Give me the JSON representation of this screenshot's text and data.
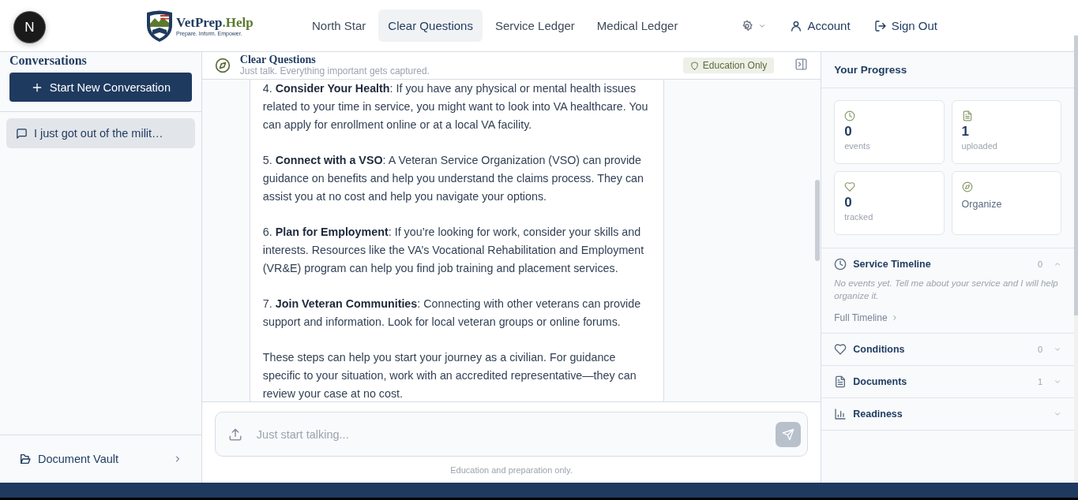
{
  "dev_badge": {
    "label": "N"
  },
  "header": {
    "logo": {
      "name": "VetPrep",
      "name_accent": ".Help",
      "tagline": "Prepare. Inform. Empower."
    },
    "nav": [
      {
        "label": "North Star",
        "selected": false
      },
      {
        "label": "Clear Questions",
        "selected": true
      },
      {
        "label": "Service Ledger",
        "selected": false
      },
      {
        "label": "Medical Ledger",
        "selected": false
      }
    ],
    "account": "Account",
    "sign_out": "Sign Out"
  },
  "sidebar": {
    "title": "Conversations",
    "new_button": "Start New Conversation",
    "conversations": [
      {
        "label": "I just got out of the milit…",
        "selected": true
      }
    ],
    "vault": "Document Vault"
  },
  "chat": {
    "title": "Clear Questions",
    "subtitle": "Just talk. Everything important gets captured.",
    "badge": "Education Only",
    "message": [
      "4. **Consider Your Health**: If you have any physical or mental health issues related to your time in service, you might want to look into VA healthcare. You can apply for enrollment online or at a local VA facility.",
      "5. **Connect with a VSO**: A Veteran Service Organization (VSO) can provide guidance on benefits and help you understand the claims process. They can assist you at no cost and help you navigate your options.",
      "6. **Plan for Employment**: If you’re looking for work, consider your skills and interests. Resources like the VA’s Vocational Rehabilitation and Employment (VR&E) program can help you find job training and placement services.",
      "7. **Join Veteran Communities**: Connecting with other veterans can provide support and information. Look for local veteran groups or online forums.",
      "These steps can help you start your journey as a civilian. For guidance specific to your situation, work with an accredited representative—they can review your case at no cost."
    ],
    "input": {
      "placeholder": "Just start talking..."
    },
    "footer": "Education and preparation only."
  },
  "progress": {
    "title": "Your Progress",
    "stats": [
      {
        "kind": "stat",
        "value": "0",
        "label": "events"
      },
      {
        "kind": "stat",
        "value": "1",
        "label": "uploaded"
      },
      {
        "kind": "stat",
        "value": "0",
        "label": "tracked"
      },
      {
        "kind": "action",
        "label": "Organize"
      }
    ],
    "sections": [
      {
        "title": "Service Timeline",
        "count": "0",
        "expanded": true,
        "empty_text": "No events yet. Tell me about your service and I will help organize it.",
        "link": "Full Timeline"
      },
      {
        "title": "Conditions",
        "count": "0",
        "expanded": false
      },
      {
        "title": "Documents",
        "count": "1",
        "expanded": false
      },
      {
        "title": "Readiness",
        "expanded": false
      }
    ]
  }
}
